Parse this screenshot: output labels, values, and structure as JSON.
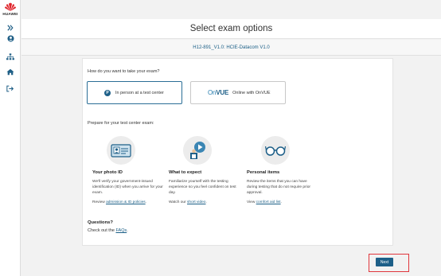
{
  "brand": {
    "name": "HUAWEI",
    "logo_color": "#e0262d"
  },
  "sidebar": {
    "items": [
      {
        "icon": "chevrons-right-icon"
      },
      {
        "icon": "user-circle-icon"
      },
      {
        "icon": "sitemap-icon"
      },
      {
        "icon": "home-icon"
      },
      {
        "icon": "sign-out-icon"
      }
    ]
  },
  "header": {
    "title": "Select exam options"
  },
  "exam": {
    "name": "H12-891_V1.0: HCIE-Datacom V1.0"
  },
  "delivery": {
    "question": "How do you want to take your exam?",
    "options": [
      {
        "label": "In person at a test center",
        "icon": "pearson-badge",
        "badge_text": "P",
        "selected": true
      },
      {
        "label": "Online with OnVUE",
        "logo_on": "On",
        "logo_vue": "VUE",
        "selected": false
      }
    ]
  },
  "prepare": {
    "heading": "Prepare for your test center exam:",
    "columns": [
      {
        "icon": "id-card-icon",
        "title": "Your photo ID",
        "desc": "We'll verify your government-issued identification (ID) when you arrive for your exam.",
        "link_prefix": "Review ",
        "link_text": "admission & ID policies",
        "link_suffix": "."
      },
      {
        "icon": "video-person-icon",
        "title": "What to expect",
        "desc": "Familiarize yourself with the testing experience so you feel confident on test day.",
        "link_prefix": "Watch our ",
        "link_text": "short video",
        "link_suffix": "."
      },
      {
        "icon": "glasses-icon",
        "title": "Personal items",
        "desc": "Review the items that you can have during testing that do not require prior approval.",
        "link_prefix": "View ",
        "link_text": "comfort aid list",
        "link_suffix": "."
      }
    ]
  },
  "questions": {
    "title": "Questions?",
    "prefix": "Check out the ",
    "link_text": "FAQs",
    "suffix": "."
  },
  "footer": {
    "next_label": "Next",
    "highlight_color": "#e0363c",
    "accent": "#1d5f88"
  }
}
